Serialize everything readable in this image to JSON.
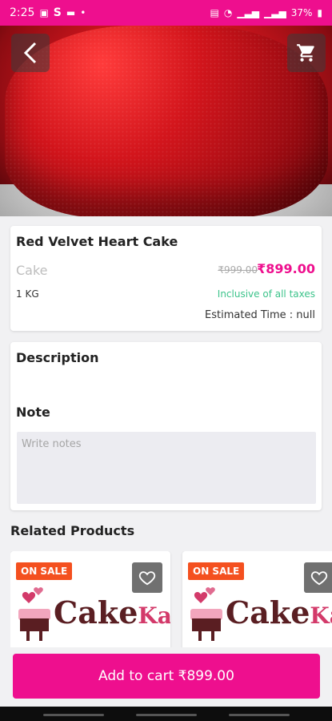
{
  "status_bar": {
    "time": "2:25",
    "left_icons": [
      "gallery-icon",
      "s-icon",
      "message-icon",
      "dot-icon"
    ],
    "right_icons": [
      "nfc-icon",
      "wifi-icon",
      "signal-icon",
      "signal-icon"
    ],
    "battery": "37%"
  },
  "header": {
    "back_icon": "chevron-left-icon",
    "cart_icon": "shopping-cart-icon"
  },
  "product": {
    "name": "Red Velvet Heart Cake",
    "category": "Cake",
    "old_price": "₹999.00",
    "price": "₹899.00",
    "weight": "1 KG",
    "tax_note": "Inclusive of all taxes",
    "estimated_time": "Estimated Time : null"
  },
  "description": {
    "title": "Description",
    "note_title": "Note",
    "notes_placeholder": "Write notes"
  },
  "related": {
    "title": "Related Products",
    "items": [
      {
        "badge": "ON SALE",
        "logo_text": "Cake",
        "logo_suffix": "Kar"
      },
      {
        "badge": "ON SALE",
        "logo_text": "Cake",
        "logo_suffix": "Ka"
      }
    ]
  },
  "footer": {
    "add_to_cart_label": "Add to cart ₹899.00"
  },
  "colors": {
    "accent": "#ee0f8e",
    "sale": "#f4501f",
    "tax_green": "#3bc38a"
  }
}
